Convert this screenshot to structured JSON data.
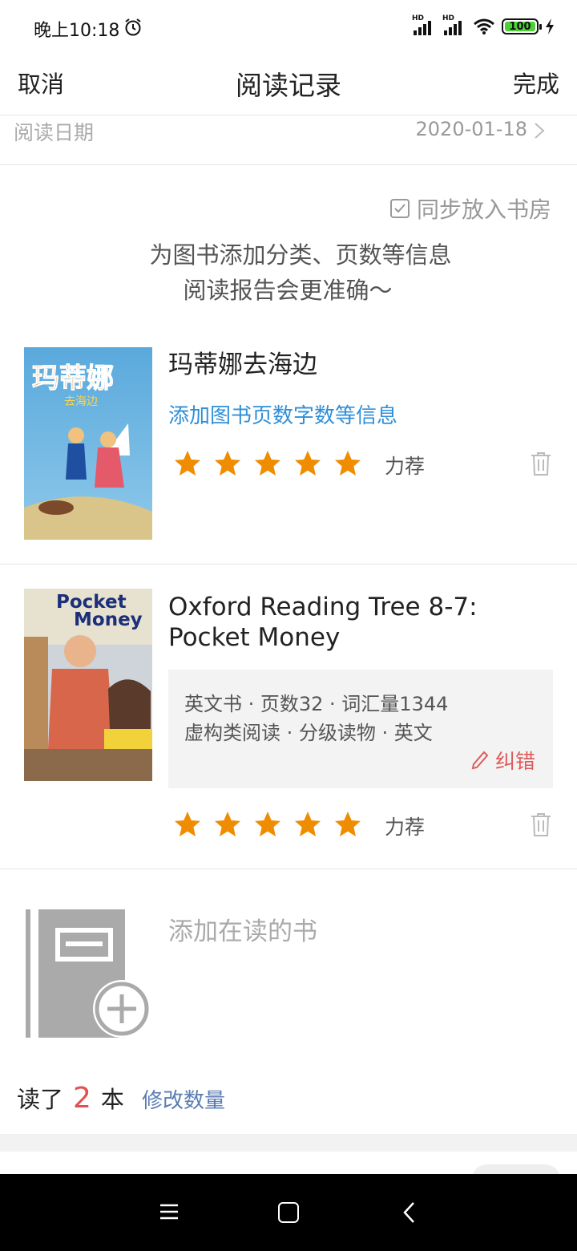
{
  "status_bar": {
    "time": "晚上10:18",
    "signal_1_label": "HD",
    "signal_2_label": "HD",
    "battery": "100",
    "battery_color": "#4cd137"
  },
  "nav": {
    "cancel": "取消",
    "title": "阅读记录",
    "done": "完成"
  },
  "date_row": {
    "label": "阅读日期",
    "value": "2020-01-18"
  },
  "sync": {
    "label": "同步放入书房",
    "checked": true
  },
  "hint": {
    "line1": "为图书添加分类、页数等信息",
    "line2": "阅读报告会更准确～"
  },
  "books": [
    {
      "title": "玛蒂娜去海边",
      "cover_title": "玛蒂娜",
      "cover_subtitle": "去海边",
      "add_info_link": "添加图书页数字数等信息",
      "stars": 5,
      "rating_label": "力荐"
    },
    {
      "title": "Oxford Reading Tree 8-7: Pocket Money",
      "cover_title_1": "Pocket",
      "cover_title_2": "Money",
      "info_line1": "英文书 · 页数32 · 词汇量1344",
      "info_line2": "虚构类阅读 · 分级读物 · 英文",
      "correct_label": "纠错",
      "stars": 5,
      "rating_label": "力荐"
    }
  ],
  "add_book": {
    "label": "添加在读的书"
  },
  "count": {
    "prefix": "读了",
    "value": "2",
    "suffix": "本",
    "edit_label": "修改数量"
  },
  "colors": {
    "star": "#f08c00",
    "link_blue": "#2f8fd8",
    "accent_red": "#e05050"
  }
}
